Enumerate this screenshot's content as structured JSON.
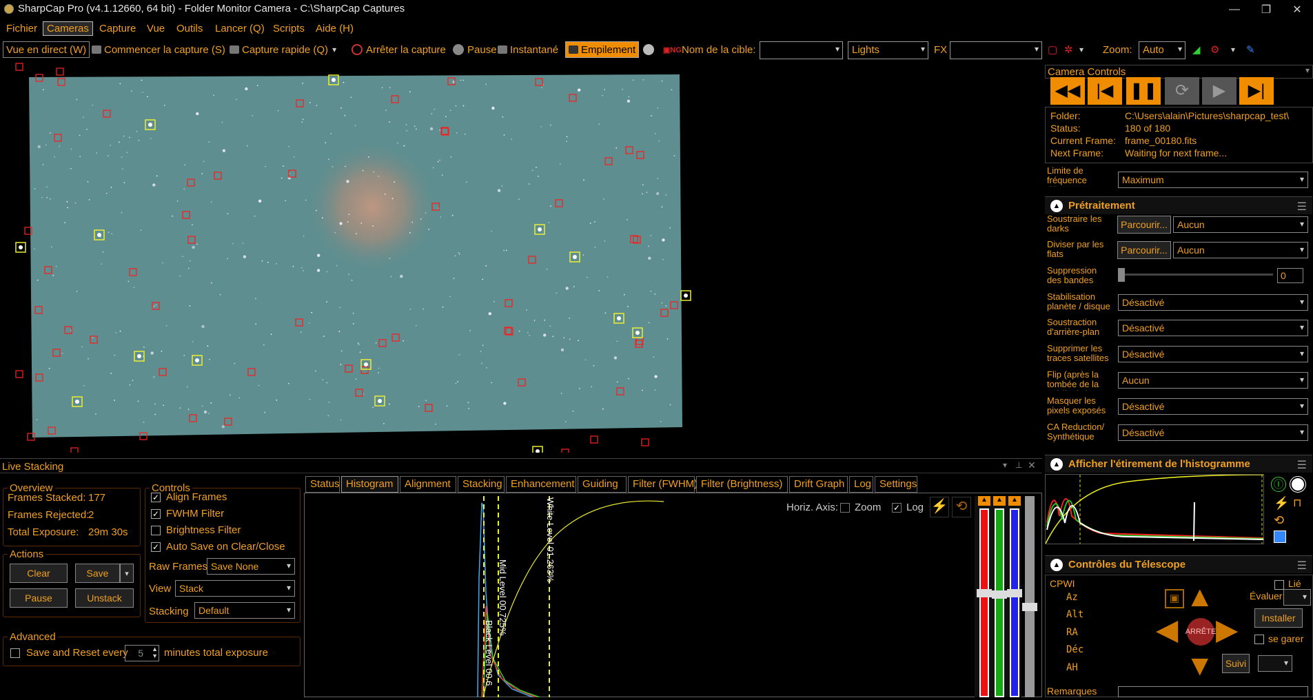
{
  "window": {
    "title": "SharpCap Pro (v4.1.12660, 64 bit) - Folder Monitor Camera - C:\\SharpCap Captures",
    "controls": [
      "—",
      "❐",
      "✕"
    ]
  },
  "menu": [
    "Fichier",
    "Cameras",
    "Capture",
    "Vue",
    "Outils",
    "Lancer (Q)",
    "Scripts",
    "Aide (H)"
  ],
  "toolbar": {
    "live": "Vue en direct (W)",
    "start": "Commencer la capture (S)",
    "quick": "Capture rapide (Q)",
    "stop": "Arrêter la capture",
    "pause": "Pause",
    "snap": "Instantané",
    "stack": "Empilement",
    "target_label": "Nom de la cible:",
    "target_value": "",
    "frame_type": "Lights",
    "fx_label": "FX",
    "fx_value": "",
    "zoom_label": "Zoom:",
    "zoom_value": "Auto"
  },
  "camera_controls": {
    "title": "Camera Controls",
    "folder_label": "Folder:",
    "folder": "C:\\Users\\alain\\Pictures\\sharpcap_test\\",
    "status_label": "Status:",
    "status": "180 of 180",
    "current_label": "Current Frame:",
    "current": "frame_00180.fits",
    "next_label": "Next Frame:",
    "next": "Waiting for next frame...",
    "fps_label": "Limite de fréquence d'images",
    "fps_value": "Maximum"
  },
  "pretraitement": {
    "title": "Prétraitement",
    "rows": [
      {
        "label": "Soustraire les darks",
        "browse": "Parcourir...",
        "value": "Aucun"
      },
      {
        "label": "Diviser par les flats",
        "browse": "Parcourir...",
        "value": "Aucun"
      },
      {
        "label": "Suppression des bandes",
        "value": "0"
      },
      {
        "label": "Stabilisation planète / disque",
        "value": "Désactivé"
      },
      {
        "label": "Soustraction d'arrière-plan",
        "value": "Désactivé"
      },
      {
        "label": "Supprimer les traces satellites",
        "value": "Désactivé"
      },
      {
        "label": "Flip (après la tombée de la nuit/à plat)",
        "value": "Aucun"
      },
      {
        "label": "Masquer les pixels exposés",
        "value": "Désactivé"
      },
      {
        "label": "CA Reduction/ Synthétique Bleu",
        "value": "Désactivé"
      }
    ]
  },
  "histogram_panel": {
    "title": "Afficher l'étirement de l'histogramme"
  },
  "telescope": {
    "title": "Contrôles du Télescope",
    "mount": "CPWI",
    "linked": "Lié",
    "axes": [
      "Az",
      "Alt",
      "RA",
      "Déc",
      "AH"
    ],
    "evaluate": "Évaluer:",
    "install": "Installer",
    "stop": "ARRÊTE",
    "park": "se garer",
    "track": "Suivi",
    "remarks": "Remarques"
  },
  "live_stacking": {
    "title": "Live Stacking",
    "overview": {
      "title": "Overview",
      "stacked_label": "Frames Stacked:",
      "stacked": "177",
      "rejected_label": "Frames Rejected:",
      "rejected": "2",
      "exposure_label": "Total Exposure:",
      "exposure": "29m 30s"
    },
    "actions": {
      "title": "Actions",
      "clear": "Clear",
      "save": "Save",
      "pause": "Pause",
      "unstack": "Unstack"
    },
    "controls": {
      "title": "Controls",
      "align": "Align Frames",
      "fwhm": "FWHM Filter",
      "brightness": "Brightness Filter",
      "autosave": "Auto Save on Clear/Close",
      "raw_label": "Raw Frames",
      "raw": "Save None",
      "view_label": "View",
      "view": "Stack",
      "stacking_label": "Stacking",
      "stacking": "Default"
    },
    "advanced": {
      "title": "Advanced",
      "save_reset": "Save and Reset every",
      "minutes": "5",
      "suffix": "minutes total exposure"
    },
    "tabs": [
      "Status",
      "Histogram",
      "Alignment",
      "Stacking",
      "Enhancement",
      "Guiding",
      "Filter (FWHM)",
      "Filter (Brightness)",
      "Drift Graph",
      "Log",
      "Settings"
    ],
    "histogram": {
      "horiz_axis": "Horiz. Axis:",
      "zoom": "Zoom",
      "log": "Log",
      "white": "White Level 01.263%",
      "mid": "Mid Level 00.725%",
      "black": "Black Level 00.6"
    }
  },
  "colors": {
    "accent": "#f0a020",
    "stack_highlight": "#f08c00"
  }
}
